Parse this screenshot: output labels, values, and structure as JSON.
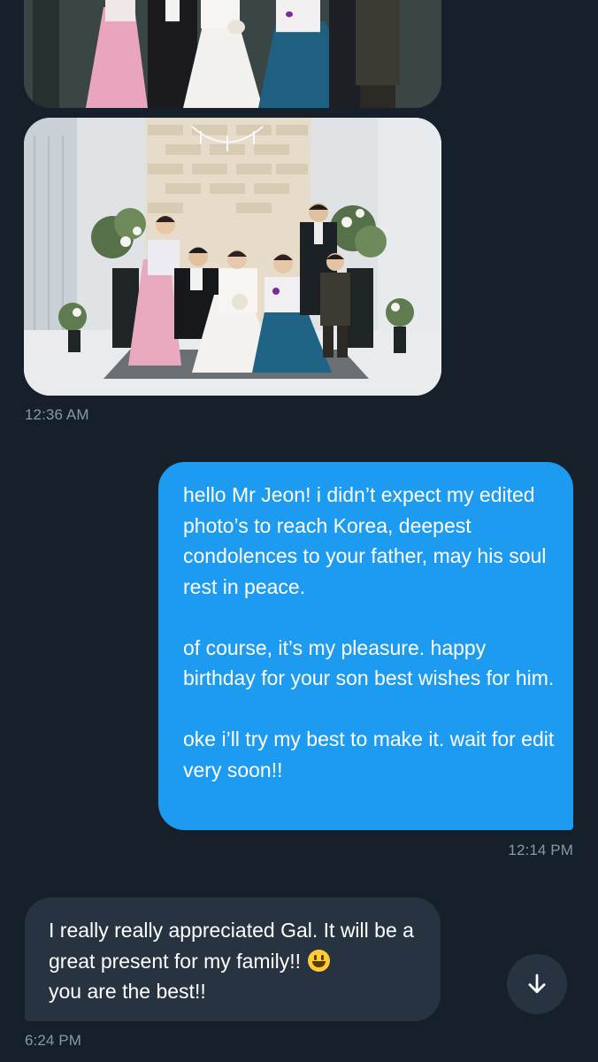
{
  "conversation": {
    "photos": [
      {
        "name": "family-portrait-photo-top"
      },
      {
        "name": "family-portrait-photo"
      }
    ],
    "timestamps": [
      "12:36 AM",
      "12:14 PM",
      "6:24 PM"
    ],
    "sent_message": {
      "paragraphs": [
        "hello Mr Jeon! i didn’t expect my edited photo’s to reach Korea, deepest condolences to your father, may his soul rest in peace.",
        "of course, it’s my pleasure. happy birthday for your son best wishes for him.",
        "oke i’ll try my best to make it. wait for edit very soon!!"
      ],
      "color": "#1d9bf0"
    },
    "received_message": {
      "text_before_emoji": "I really really appreciated Gal. It will be a great present for my family!!",
      "emoji": "grinning-face-emoji",
      "text_after_emoji": "you are the best!!",
      "color": "#273340"
    },
    "scroll_button": {
      "icon": "arrow-down-icon"
    }
  },
  "theme": {
    "background": "#15202b",
    "timestamp_color": "#8899a6"
  }
}
